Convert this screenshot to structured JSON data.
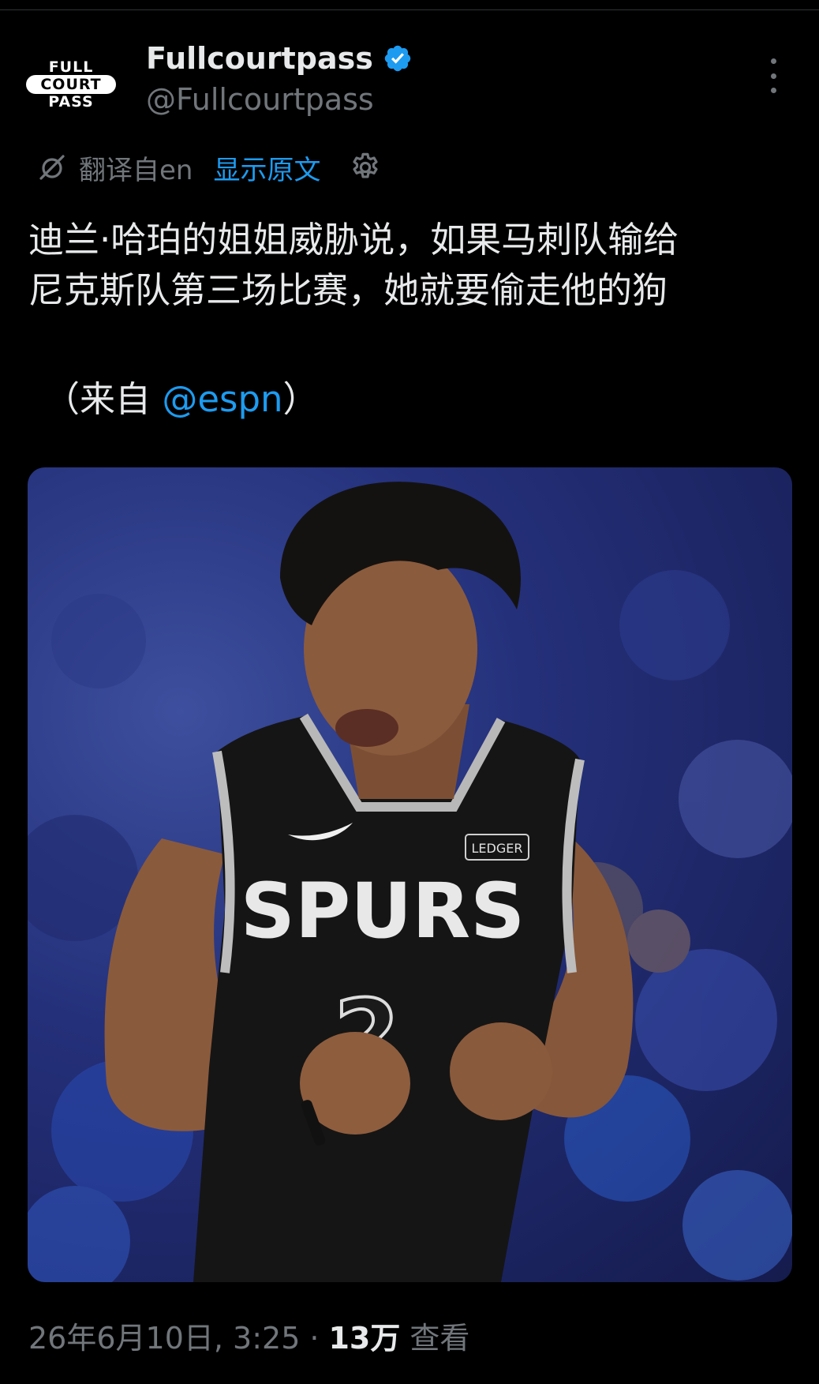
{
  "account": {
    "display_name": "Fullcourtpass",
    "handle": "@Fullcourtpass",
    "avatar_logo": {
      "line1": "FULL",
      "line2": "COURT",
      "line3": "PASS"
    },
    "verified_icon": "verified-badge-icon"
  },
  "translation": {
    "translated_from": "翻译自en",
    "show_original": "显示原文"
  },
  "tweet": {
    "line1": "迪兰·哈珀的姐姐威胁说，如果马刺队输给",
    "line2": "尼克斯队第三场比赛，她就要偷走他的狗",
    "source_prefix": "（来自 ",
    "source_mention": "@espn",
    "source_suffix": "）"
  },
  "media": {
    "jersey_text": "SPURS",
    "jersey_number": "2",
    "patch_text": "LEDGER"
  },
  "meta": {
    "timestamp": "26年6月10日, 3:25",
    "separator": "·",
    "view_count": "13万",
    "views_label": "查看"
  },
  "colors": {
    "background": "#000000",
    "primary_text": "#e7e9ea",
    "secondary_text": "#71767b",
    "link": "#1d9bf0",
    "verified": "#1d9bf0"
  }
}
